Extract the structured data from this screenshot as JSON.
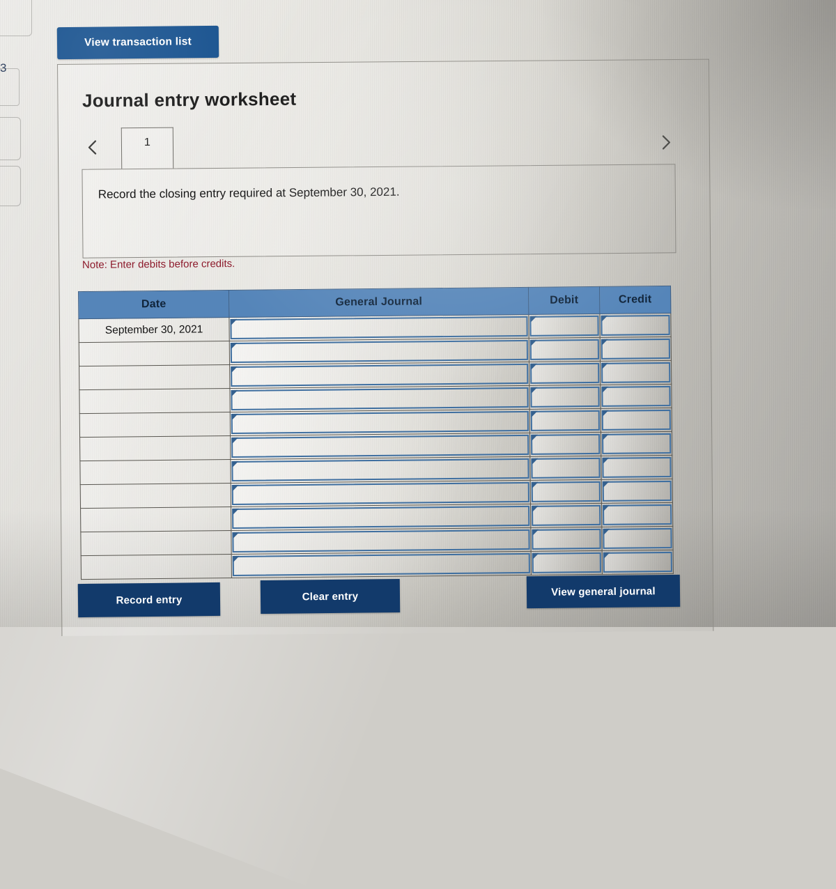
{
  "page_marker": "3",
  "toolbar": {
    "view_transaction_list_label": "View transaction list"
  },
  "worksheet": {
    "title": "Journal entry worksheet",
    "prev_icon": "chevron-left-icon",
    "next_icon": "chevron-right-icon",
    "tabs": [
      {
        "label": "1",
        "selected": true
      }
    ],
    "instruction": "Record the closing entry required at September 30, 2021.",
    "note": "Note: Enter debits before credits."
  },
  "table": {
    "columns": [
      "Date",
      "General Journal",
      "Debit",
      "Credit"
    ],
    "rows": [
      {
        "date": "September 30, 2021",
        "journal": "",
        "debit": "",
        "credit": ""
      },
      {
        "date": "",
        "journal": "",
        "debit": "",
        "credit": ""
      },
      {
        "date": "",
        "journal": "",
        "debit": "",
        "credit": ""
      },
      {
        "date": "",
        "journal": "",
        "debit": "",
        "credit": ""
      },
      {
        "date": "",
        "journal": "",
        "debit": "",
        "credit": ""
      },
      {
        "date": "",
        "journal": "",
        "debit": "",
        "credit": ""
      },
      {
        "date": "",
        "journal": "",
        "debit": "",
        "credit": ""
      },
      {
        "date": "",
        "journal": "",
        "debit": "",
        "credit": ""
      },
      {
        "date": "",
        "journal": "",
        "debit": "",
        "credit": ""
      },
      {
        "date": "",
        "journal": "",
        "debit": "",
        "credit": ""
      },
      {
        "date": "",
        "journal": "",
        "debit": "",
        "credit": ""
      }
    ]
  },
  "footer": {
    "record_entry_label": "Record entry",
    "clear_entry_label": "Clear entry",
    "view_general_journal_label": "View general journal"
  },
  "colors": {
    "primary_button": "#18528f",
    "footer_button": "#123a6b",
    "table_header": "#5585b9",
    "note_text": "#8d1b2c",
    "select_border": "#3f6fa0"
  }
}
